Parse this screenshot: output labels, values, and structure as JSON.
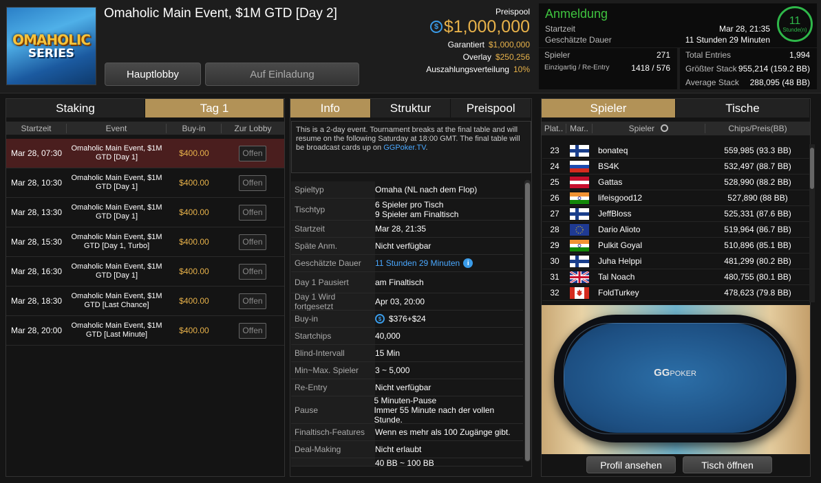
{
  "header": {
    "logo_line1": "OMAHOLIC",
    "logo_line2": "SERIES",
    "title": "Omaholic Main Event, $1M GTD [Day 2]",
    "btn_lobby": "Hauptlobby",
    "btn_invite": "Auf Einladung"
  },
  "prizepool": {
    "label": "Preispool",
    "amount": "$1,000,000",
    "rows": [
      {
        "k": "Garantiert",
        "v": "$1,000,000"
      },
      {
        "k": "Overlay",
        "v": "$250,256"
      },
      {
        "k": "Auszahlungsverteilung",
        "v": "10%"
      }
    ]
  },
  "registration": {
    "title": "Anmeldung",
    "start_label": "Startzeit",
    "start_value": "Mar 28, 21:35",
    "duration_label": "Geschätzte Dauer",
    "duration_value": "11 Stunden 29 Minuten",
    "ring_value": "11",
    "ring_unit": "Stunde(n)"
  },
  "stats_left": [
    {
      "k": "Spieler",
      "v": "271"
    },
    {
      "k": "Einzigartig / Re-Entry",
      "v": "1418 / 576"
    }
  ],
  "stats_right": [
    {
      "k": "Total Entries",
      "v": "1,994"
    },
    {
      "k": "Größter Stack",
      "v": "955,214 (159.2 BB)"
    },
    {
      "k": "Average Stack",
      "v": "288,095 (48 BB)"
    }
  ],
  "left_panel": {
    "tabs": [
      "Staking",
      "Tag 1"
    ],
    "columns": [
      "Startzeit",
      "Event",
      "Buy-in",
      "Zur Lobby"
    ],
    "rows": [
      {
        "time": "Mar 28, 07:30",
        "event": "Omaholic Main Event, $1M GTD [Day 1]",
        "buyin": "$400.00",
        "btn": "Offen"
      },
      {
        "time": "Mar 28, 10:30",
        "event": "Omaholic Main Event, $1M GTD [Day 1]",
        "buyin": "$400.00",
        "btn": "Offen"
      },
      {
        "time": "Mar 28, 13:30",
        "event": "Omaholic Main Event, $1M GTD [Day 1]",
        "buyin": "$400.00",
        "btn": "Offen"
      },
      {
        "time": "Mar 28, 15:30",
        "event": "Omaholic Main Event, $1M GTD [Day 1, Turbo]",
        "buyin": "$400.00",
        "btn": "Offen"
      },
      {
        "time": "Mar 28, 16:30",
        "event": "Omaholic Main Event, $1M GTD [Day 1]",
        "buyin": "$400.00",
        "btn": "Offen"
      },
      {
        "time": "Mar 28, 18:30",
        "event": "Omaholic Main Event, $1M GTD [Last Chance]",
        "buyin": "$400.00",
        "btn": "Offen"
      },
      {
        "time": "Mar 28, 20:00",
        "event": "Omaholic Main Event, $1M GTD [Last Minute]",
        "buyin": "$400.00",
        "btn": "Offen"
      }
    ]
  },
  "info_panel": {
    "tabs": [
      "Info",
      "Struktur",
      "Preispool"
    ],
    "description": "This is a 2-day event. Tournament breaks at the final table and will resume on the following Saturday at 18:00 GMT. The final table will be broadcast cards up on ",
    "description_link": "GGPoker.TV",
    "description_end": ".",
    "rows": [
      {
        "k": "Spieltyp",
        "v": "Omaha (NL nach dem Flop)"
      },
      {
        "k": "Tischtyp",
        "v": "6 Spieler pro Tisch",
        "v2": "9 Spieler am Finaltisch"
      },
      {
        "k": "Startzeit",
        "v": "Mar 28, 21:35"
      },
      {
        "k": "Späte Anm.",
        "v": "Nicht verfügbar"
      },
      {
        "k": "Geschätzte Dauer",
        "v": "11 Stunden 29 Minuten"
      },
      {
        "k": "Day 1 Pausiert",
        "v": "am Finaltisch"
      },
      {
        "k": "Day 1 Wird fortgesetzt",
        "v": "Apr 03, 20:00"
      },
      {
        "k": "Buy-in",
        "v": "$376+$24"
      },
      {
        "k": "Startchips",
        "v": "40,000"
      },
      {
        "k": "Blind-Intervall",
        "v": "15 Min"
      },
      {
        "k": "Min~Max. Spieler",
        "v": "3 ~ 5,000"
      },
      {
        "k": "Re-Entry",
        "v": "Nicht verfügbar"
      },
      {
        "k": "Pause",
        "v": "5 Minuten-Pause",
        "v2": "Immer 55 Minute nach der vollen Stunde."
      },
      {
        "k": "Finaltisch-Features",
        "v": "Wenn es mehr als 100 Zugänge gibt."
      },
      {
        "k": "Deal-Making",
        "v": "Nicht erlaubt"
      },
      {
        "k": "",
        "v": "40 BB ~ 100 BB"
      }
    ]
  },
  "players_panel": {
    "tabs": [
      "Spieler",
      "Tische"
    ],
    "columns": [
      "Plat..",
      "Mar..",
      "Spieler",
      "Chips/Preis(BB)"
    ],
    "rows": [
      {
        "place": "23",
        "flag": "fi",
        "name": "bonateq",
        "chips": "559,985 (93.3 BB)"
      },
      {
        "place": "24",
        "flag": "ru",
        "name": "BS4K",
        "chips": "532,497 (88.7 BB)"
      },
      {
        "place": "25",
        "flag": "at",
        "name": "Gattas",
        "chips": "528,990 (88.2 BB)"
      },
      {
        "place": "26",
        "flag": "in",
        "name": "lifeisgood12",
        "chips": "527,890 (88 BB)"
      },
      {
        "place": "27",
        "flag": "fi",
        "name": "JeffBloss",
        "chips": "525,331 (87.6 BB)"
      },
      {
        "place": "28",
        "flag": "eu",
        "name": "Dario Alioto",
        "chips": "519,964 (86.7 BB)"
      },
      {
        "place": "29",
        "flag": "in",
        "name": "Pulkit Goyal",
        "chips": "510,896 (85.1 BB)"
      },
      {
        "place": "30",
        "flag": "fi",
        "name": "Juha Helppi",
        "chips": "481,299 (80.2 BB)"
      },
      {
        "place": "31",
        "flag": "gb",
        "name": "Tal Noach",
        "chips": "480,755 (80.1 BB)"
      },
      {
        "place": "32",
        "flag": "ca",
        "name": "FoldTurkey",
        "chips": "478,623 (79.8 BB)"
      }
    ],
    "table_logo": "GG",
    "table_logo_suffix": "POKER",
    "btn_profile": "Profil ansehen",
    "btn_table": "Tisch öffnen"
  }
}
